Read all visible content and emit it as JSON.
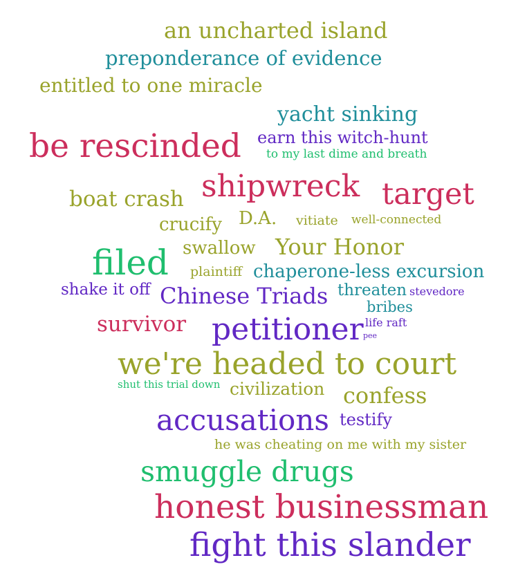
{
  "cloud": {
    "words": [
      "an uncharted island",
      "preponderance of evidence",
      "entitled to one miracle",
      "yacht sinking",
      "be rescinded",
      "earn this witch-hunt",
      "to my last dime and breath",
      "shipwreck",
      "target",
      "boat crash",
      "crucify",
      "D.A.",
      "vitiate",
      "well-connected",
      "swallow",
      "Your Honor",
      "filed",
      "plaintiff",
      "chaperone-less excursion",
      "shake it off",
      "Chinese Triads",
      "threaten",
      "stevedore",
      "bribes",
      "survivor",
      "petitioner",
      "life raft",
      "pee",
      "we're headed to court",
      "shut this trial down",
      "civilization",
      "confess",
      "accusations",
      "testify",
      "he was cheating on me with my sister",
      "smuggle drugs",
      "honest businessman",
      "fight this slander"
    ]
  },
  "colors": {
    "olive": "#99a32b",
    "teal": "#1f8e9a",
    "crimson": "#cc2e5c",
    "green": "#1fbe6e",
    "violet": "#6128c4",
    "background": "#ffffff"
  }
}
